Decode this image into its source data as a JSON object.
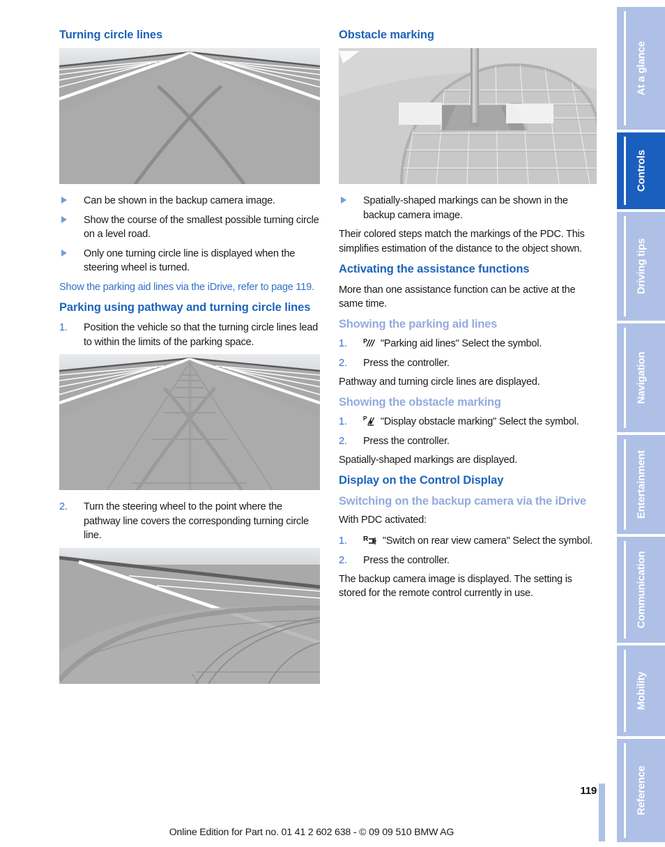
{
  "document": {
    "page_number": "119",
    "footer": "Online Edition for Part no. 01 41 2 602 638 - © 09 09 510 BMW AG"
  },
  "left_column": {
    "heading_turning_circle": "Turning circle lines",
    "figure_1_caption": "backup-camera-turning-circle-lines",
    "bullets": [
      "Can be shown in the backup camera image.",
      "Show the course of the smallest possible turning circle on a level road.",
      "Only one turning circle line is displayed when the steering wheel is turned."
    ],
    "cross_reference": "Show the parking aid lines via the iDrive, refer to page 119.",
    "heading_parking": "Parking using pathway and turning circle lines",
    "step_1": "Position the vehicle so that the turning circle lines lead to within the limits of the parking space.",
    "figure_2_caption": "backup-camera-pathway-and-turning-circle-lines",
    "step_2": "Turn the steering wheel to the point where the pathway line covers the corresponding turning circle line.",
    "figure_3_caption": "backup-camera-pathway-covering-turning-circle-line"
  },
  "right_column": {
    "heading_obstacle": "Obstacle marking",
    "figure_4_caption": "backup-camera-obstacle-marking-pole",
    "bullets": [
      "Spatially-shaped markings can be shown in the backup camera image."
    ],
    "paragraph_colored_steps": "Their colored steps match the markings of the PDC. This simplifies estimation of the distance to the object shown.",
    "heading_activating": "Activating the assistance functions",
    "paragraph_more_than_one": "More than one assistance function can be active at the same time.",
    "heading_showing_parking_aid": "Showing the parking aid lines",
    "parking_aid_steps": [
      "\"Parking aid lines\" Select the symbol.",
      "Press the controller."
    ],
    "parking_aid_symbol": "parking-aid-lines-symbol",
    "parking_aid_result": "Pathway and turning circle lines are displayed.",
    "heading_showing_obstacle": "Showing the obstacle marking",
    "obstacle_steps": [
      "\"Display obstacle marking\" Select the symbol.",
      "Press the controller."
    ],
    "obstacle_symbol": "obstacle-marking-symbol",
    "obstacle_result": "Spatially-shaped markings are displayed.",
    "heading_display_control": "Display on the Control Display",
    "heading_switching_on": "Switching on the backup camera via the iDrive",
    "paragraph_with_pdc": "With PDC activated:",
    "camera_steps": [
      "\"Switch on rear view camera\" Select the symbol.",
      "Press the controller."
    ],
    "camera_symbol": "rear-view-camera-symbol",
    "camera_result": "The backup camera image is displayed. The setting is stored for the remote control currently in use."
  },
  "side_tabs": [
    {
      "label": "At a glance",
      "active": false
    },
    {
      "label": "Controls",
      "active": true
    },
    {
      "label": "Driving tips",
      "active": false
    },
    {
      "label": "Navigation",
      "active": false
    },
    {
      "label": "Entertainment",
      "active": false
    },
    {
      "label": "Communication",
      "active": false
    },
    {
      "label": "Mobility",
      "active": false
    },
    {
      "label": "Reference",
      "active": false
    }
  ],
  "colors": {
    "heading_primary": "#1d64ba",
    "heading_secondary": "#93abdd",
    "link": "#2f72c6",
    "tab_inactive": "#aec0e6",
    "tab_active": "#1b5fbe",
    "body_text": "#1a1a1a"
  }
}
